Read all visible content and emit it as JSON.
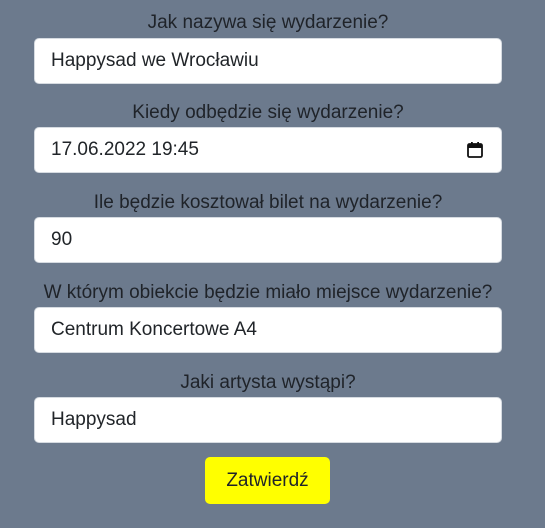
{
  "form": {
    "fields": [
      {
        "label": "Jak nazywa się wydarzenie?",
        "value": "Happysad we Wrocławiu"
      },
      {
        "label": "Kiedy odbędzie się wydarzenie?",
        "value": "17.06.2022 19:45",
        "icon": "calendar-icon"
      },
      {
        "label": "Ile będzie kosztował bilet na wydarzenie?",
        "value": "90"
      },
      {
        "label": "W którym obiekcie będzie miało miejsce wydarzenie?",
        "value": "Centrum Koncertowe A4"
      },
      {
        "label": "Jaki artysta wystąpi?",
        "value": "Happysad"
      }
    ],
    "submit_label": "Zatwierdź"
  },
  "colors": {
    "background": "#6c7a8d",
    "submit_button": "#ffff00"
  }
}
